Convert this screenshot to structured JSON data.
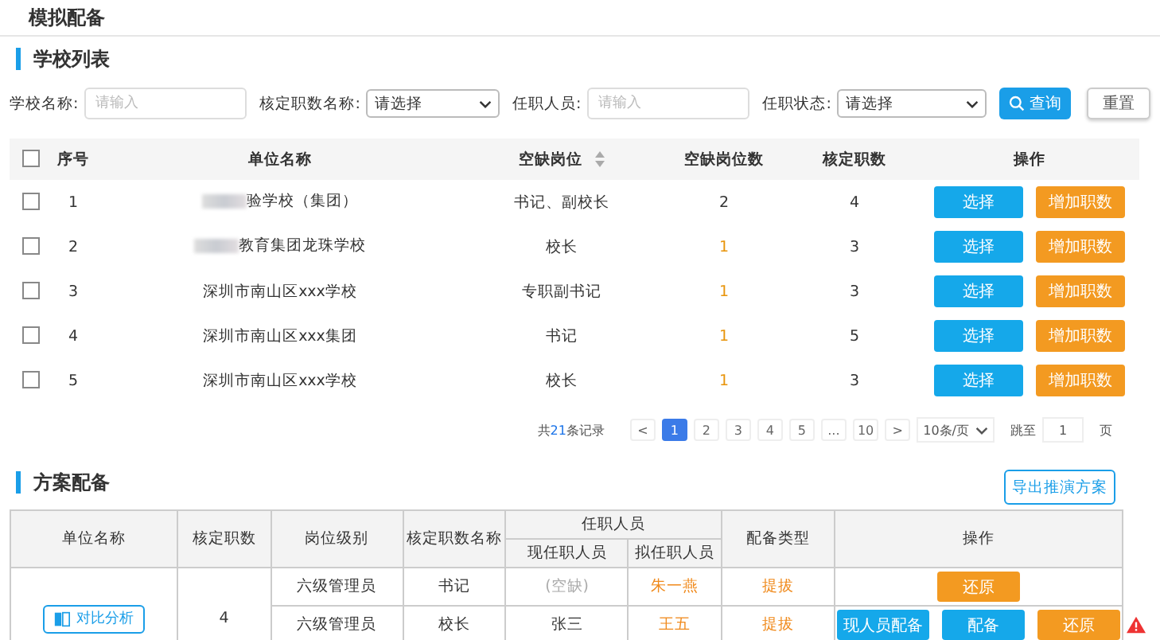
{
  "page_title": "模拟配备",
  "school_section": {
    "title": "学校列表",
    "filters": [
      {
        "kind": "input",
        "label": "学校名称:",
        "placeholder": "请输入"
      },
      {
        "kind": "select",
        "label": "核定职数名称:",
        "value": "请选择"
      },
      {
        "kind": "input",
        "label": "任职人员:",
        "placeholder": "请输入"
      },
      {
        "kind": "select",
        "label": "任职状态:",
        "value": "请选择"
      }
    ],
    "search_button": "查询",
    "reset_button": "重置",
    "all_checked": false,
    "columns": [
      "序号",
      "单位名称",
      "空缺岗位",
      "空缺岗位数",
      "核定职数",
      "操作"
    ],
    "rows": [
      {
        "checked": false,
        "index": "1",
        "blurred_prefix": true,
        "name": "验学校（集团）",
        "vacant": "书记、副校长",
        "vacant_count": "2",
        "highlight": false,
        "quota": "4",
        "select": "选择",
        "add": "增加职数"
      },
      {
        "checked": false,
        "index": "2",
        "blurred_prefix": true,
        "name": "教育集团龙珠学校",
        "vacant": "校长",
        "vacant_count": "1",
        "highlight": true,
        "quota": "3",
        "select": "选择",
        "add": "增加职数"
      },
      {
        "checked": false,
        "index": "3",
        "blurred_prefix": false,
        "name": "深圳市南山区xxx学校",
        "vacant": "专职副书记",
        "vacant_count": "1",
        "highlight": true,
        "quota": "3",
        "select": "选择",
        "add": "增加职数"
      },
      {
        "checked": false,
        "index": "4",
        "blurred_prefix": false,
        "name": "深圳市南山区xxx集团",
        "vacant": "书记",
        "vacant_count": "1",
        "highlight": true,
        "quota": "5",
        "select": "选择",
        "add": "增加职数"
      },
      {
        "checked": false,
        "index": "5",
        "blurred_prefix": false,
        "name": "深圳市南山区xxx学校",
        "vacant": "校长",
        "vacant_count": "1",
        "highlight": true,
        "quota": "3",
        "select": "选择",
        "add": "增加职数"
      }
    ],
    "pagination": {
      "total": "共**21**条记录",
      "prev": "<",
      "pages": [
        {
          "label": "1",
          "selected": true
        },
        {
          "label": "2",
          "selected": false
        },
        {
          "label": "3",
          "selected": false
        },
        {
          "label": "4",
          "selected": false
        },
        {
          "label": "5",
          "selected": false
        },
        {
          "label": "...",
          "selected": false
        },
        {
          "label": "10",
          "selected": false
        }
      ],
      "next": ">",
      "page_size": "10条/页",
      "jump_label": "跳至",
      "jump_value": "1",
      "page_unit": "页"
    }
  },
  "plan_section": {
    "title": "方案配备",
    "export_button": "导出推演方案",
    "columns": {
      "unit": "单位名称",
      "quota": "核定职数",
      "level": "岗位级别",
      "quota_name": "核定职数名称",
      "staff": "任职人员",
      "current": "现任职人员",
      "proposed": "拟任职人员",
      "type": "配备类型",
      "ops": "操作"
    },
    "compare_button": "对比分析",
    "quota_value": "4",
    "rows": [
      {
        "level": "六级管理员",
        "quota_name": "书记",
        "current": "(空缺)",
        "current_vacant": true,
        "proposed": "朱一燕",
        "type": "提拔",
        "buttons": [
          {
            "kind": "restore",
            "label": "还原"
          }
        ],
        "warning": false
      },
      {
        "level": "六级管理员",
        "quota_name": "校长",
        "current": "张三",
        "current_vacant": false,
        "proposed": "王五",
        "type": "提拔",
        "buttons": [
          {
            "kind": "primary",
            "label": "现人员配备"
          },
          {
            "kind": "primary",
            "label": "配备"
          },
          {
            "kind": "restore",
            "label": "还原"
          }
        ],
        "warning": true
      }
    ]
  }
}
